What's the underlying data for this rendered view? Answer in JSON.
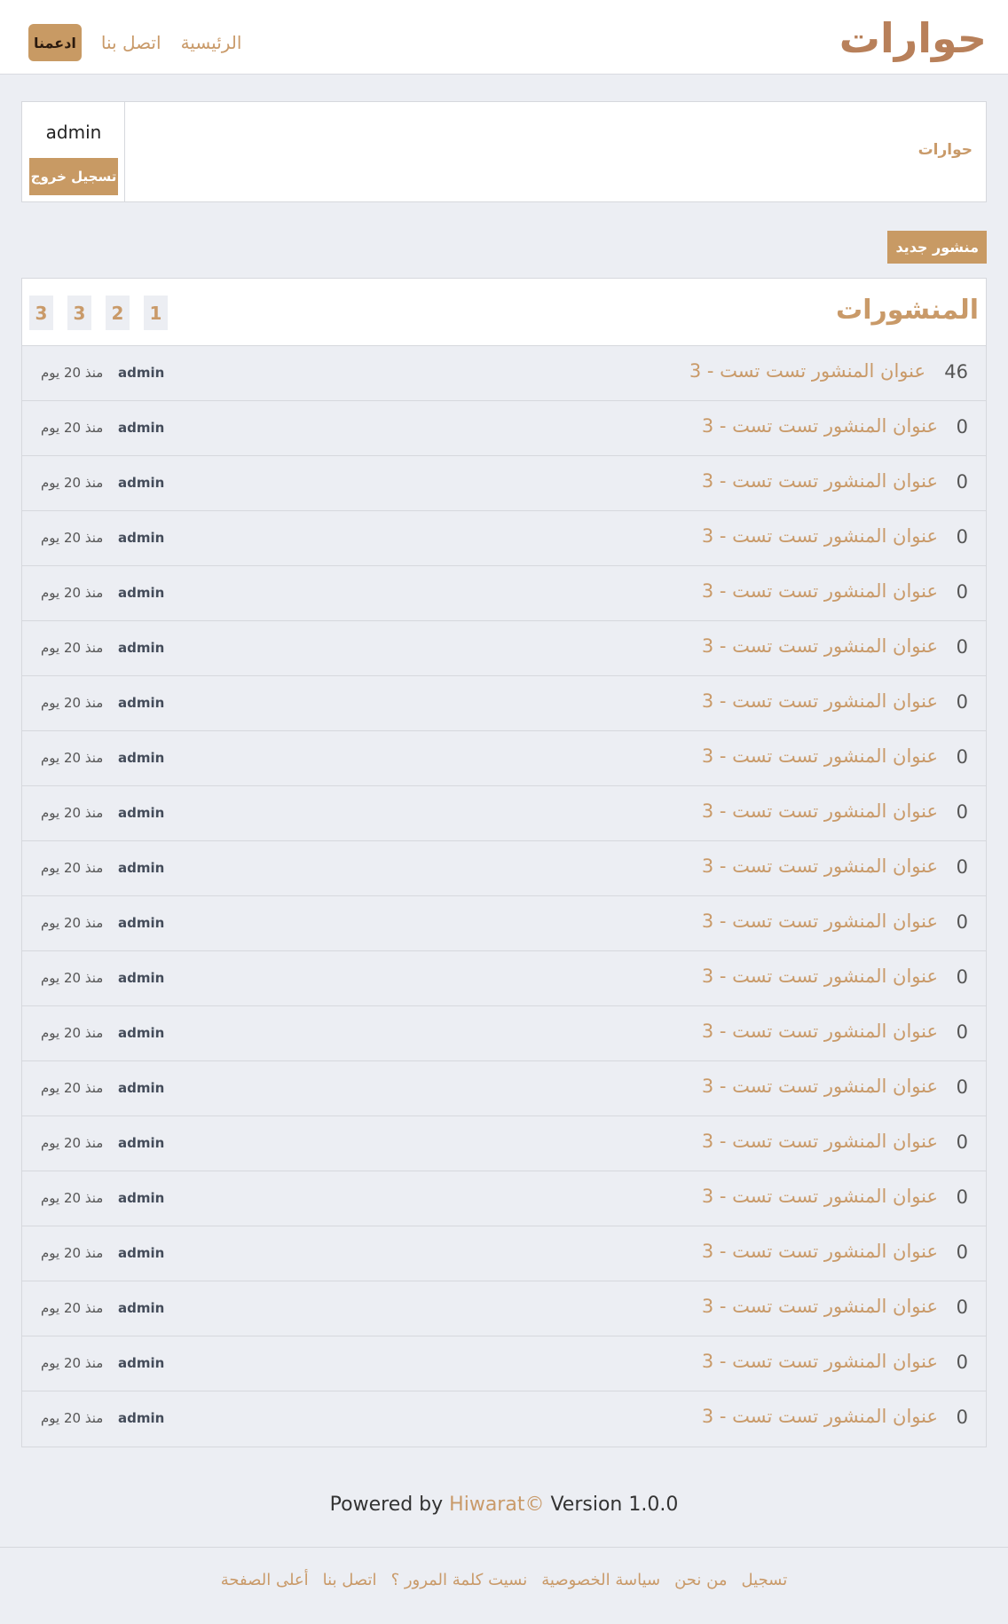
{
  "header": {
    "logo": "حوارات",
    "nav": {
      "home": "الرئيسية",
      "contact": "اتصل بنا",
      "support": "ادعمنا"
    }
  },
  "userbox": {
    "site_name": "حوارات",
    "username": "admin",
    "logout": "تسجيل خروج"
  },
  "new_post": "منشور جديد",
  "posts": {
    "title": "المنشورات",
    "pages": [
      "1",
      "2",
      "3",
      "3"
    ],
    "rows": [
      {
        "count": "46",
        "title": "عنوان المنشور تست تست - 3",
        "author": "admin",
        "time": "منذ 20 يوم"
      },
      {
        "count": "0",
        "title": "عنوان المنشور تست تست - 3",
        "author": "admin",
        "time": "منذ 20 يوم"
      },
      {
        "count": "0",
        "title": "عنوان المنشور تست تست - 3",
        "author": "admin",
        "time": "منذ 20 يوم"
      },
      {
        "count": "0",
        "title": "عنوان المنشور تست تست - 3",
        "author": "admin",
        "time": "منذ 20 يوم"
      },
      {
        "count": "0",
        "title": "عنوان المنشور تست تست - 3",
        "author": "admin",
        "time": "منذ 20 يوم"
      },
      {
        "count": "0",
        "title": "عنوان المنشور تست تست - 3",
        "author": "admin",
        "time": "منذ 20 يوم"
      },
      {
        "count": "0",
        "title": "عنوان المنشور تست تست - 3",
        "author": "admin",
        "time": "منذ 20 يوم"
      },
      {
        "count": "0",
        "title": "عنوان المنشور تست تست - 3",
        "author": "admin",
        "time": "منذ 20 يوم"
      },
      {
        "count": "0",
        "title": "عنوان المنشور تست تست - 3",
        "author": "admin",
        "time": "منذ 20 يوم"
      },
      {
        "count": "0",
        "title": "عنوان المنشور تست تست - 3",
        "author": "admin",
        "time": "منذ 20 يوم"
      },
      {
        "count": "0",
        "title": "عنوان المنشور تست تست - 3",
        "author": "admin",
        "time": "منذ 20 يوم"
      },
      {
        "count": "0",
        "title": "عنوان المنشور تست تست - 3",
        "author": "admin",
        "time": "منذ 20 يوم"
      },
      {
        "count": "0",
        "title": "عنوان المنشور تست تست - 3",
        "author": "admin",
        "time": "منذ 20 يوم"
      },
      {
        "count": "0",
        "title": "عنوان المنشور تست تست - 3",
        "author": "admin",
        "time": "منذ 20 يوم"
      },
      {
        "count": "0",
        "title": "عنوان المنشور تست تست - 3",
        "author": "admin",
        "time": "منذ 20 يوم"
      },
      {
        "count": "0",
        "title": "عنوان المنشور تست تست - 3",
        "author": "admin",
        "time": "منذ 20 يوم"
      },
      {
        "count": "0",
        "title": "عنوان المنشور تست تست - 3",
        "author": "admin",
        "time": "منذ 20 يوم"
      },
      {
        "count": "0",
        "title": "عنوان المنشور تست تست - 3",
        "author": "admin",
        "time": "منذ 20 يوم"
      },
      {
        "count": "0",
        "title": "عنوان المنشور تست تست - 3",
        "author": "admin",
        "time": "منذ 20 يوم"
      },
      {
        "count": "0",
        "title": "عنوان المنشور تست تست - 3",
        "author": "admin",
        "time": "منذ 20 يوم"
      }
    ]
  },
  "powered": {
    "prefix": "Powered by",
    "brand": "Hiwarat©",
    "version": "Version 1.0.0"
  },
  "footer": {
    "links": [
      "تسجيل",
      "من نحن",
      "سياسة الخصوصية",
      "نسيت كلمة المرور ؟",
      "اتصل بنا",
      "أعلى الصفحة"
    ]
  },
  "colors": {
    "accent": "#c99a69",
    "button": "#c89a64",
    "background": "#eceef3"
  }
}
